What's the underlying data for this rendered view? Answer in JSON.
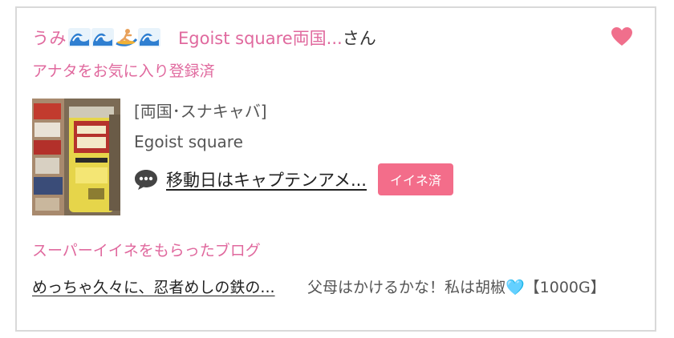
{
  "header": {
    "user_name": "うみ",
    "user_emojis": [
      "wave-icon",
      "wave-icon",
      "surfer-icon",
      "wave-icon"
    ],
    "shop_name": "Egoist square両国...",
    "honorific": "さん"
  },
  "fav_note": "アナタをお気に入り登録済",
  "entry": {
    "category": "[両国･スナキャバ]",
    "shop": "Egoist square",
    "comment": "移動日はキャプテンアメ...",
    "iine_label": "イイネ済"
  },
  "super_iine": {
    "title": "スーパーイイネをもらったブログ",
    "blog_title": "めっちゃ久々に、忍者めしの鉄の...",
    "blog_text": "父母はかけるかな！私は胡椒🩵【1000G】"
  },
  "colors": {
    "accent_pink": "#e0699e",
    "button_pink": "#f36d8a",
    "heart_pink": "#f06f8c"
  }
}
